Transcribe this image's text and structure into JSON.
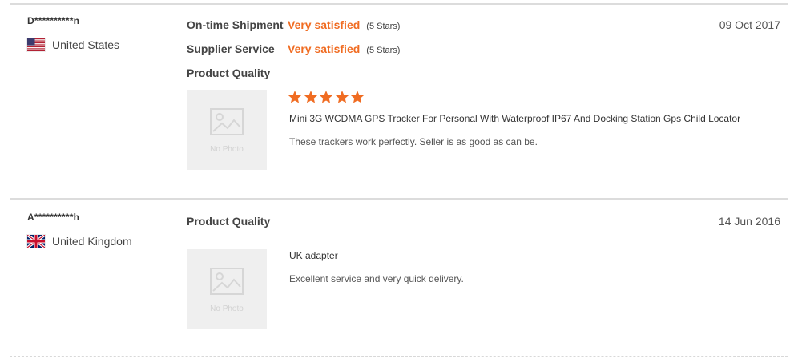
{
  "reviews": [
    {
      "username": "D**********n",
      "country": "United States",
      "flag": "us-flag-icon",
      "date": "09 Oct 2017",
      "ratings": [
        {
          "label": "On-time Shipment",
          "value": "Very satisfied",
          "stars_text": "(5 Stars)"
        },
        {
          "label": "Supplier Service",
          "value": "Very satisfied",
          "stars_text": "(5 Stars)"
        }
      ],
      "product_quality_label": "Product Quality",
      "product_quality_stars": 5,
      "thumbnail_text": "No Photo",
      "product_title": "Mini 3G WCDMA GPS Tracker For Personal With Waterproof IP67 And Docking Station Gps Child Locator",
      "comment": "These trackers work perfectly. Seller is as good as can be."
    },
    {
      "username": "A**********h",
      "country": "United Kingdom",
      "flag": "uk-flag-icon",
      "date": "14 Jun 2016",
      "product_quality_label": "Product Quality",
      "thumbnail_text": "No Photo",
      "product_title": "UK adapter",
      "comment": "Excellent service and very quick delivery."
    }
  ],
  "colors": {
    "accent": "#f06c22",
    "divider": "#dcdcdc",
    "thumb_bg": "#efefef"
  }
}
